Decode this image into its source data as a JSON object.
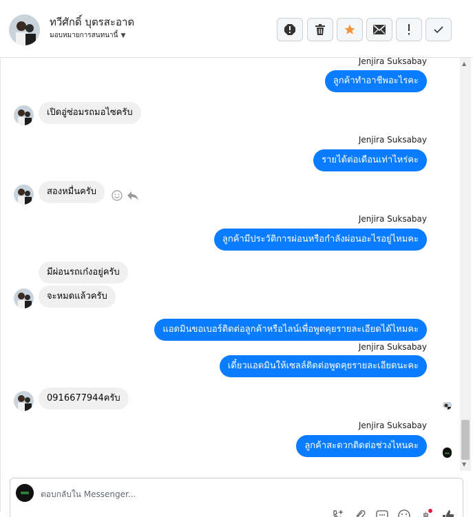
{
  "header": {
    "name": "ทวีศักดิ์ บุตรสะอาด",
    "subtitle": "มอบหมายการสนทนานี้",
    "buttons": [
      "spam-icon",
      "trash-icon",
      "star-icon",
      "mail-icon",
      "exclamation-icon",
      "check-icon"
    ],
    "star_color": "#f7923a"
  },
  "messages": {
    "m1": {
      "sender": "Jenjira Suksabay",
      "text": "ลูกค้าทำอาชีพอะไรคะ"
    },
    "m2": {
      "text": "เปิดอู่ซ่อมรถมอไซครับ"
    },
    "m3": {
      "sender": "Jenjira Suksabay",
      "text": "รายได้ต่อเดือนเท่าไหร่คะ"
    },
    "m4": {
      "text": "สองหมื่นครับ"
    },
    "m5": {
      "sender": "Jenjira Suksabay",
      "text": "ลูกค้ามีประวัติการผ่อนหรือกำลังผ่อนอะไรอยู่ไหมคะ"
    },
    "m6": {
      "text": "มีผ่อนรถเก๋งอยู่ครับ"
    },
    "m7": {
      "text": "จะหมดแล้วครับ"
    },
    "m8": {
      "text": "แอดมินขอเบอร์ติดต่อลูกค้าหรือไลน์เพื่อพูดคุยรายละเอียดได้ไหมคะ"
    },
    "m9": {
      "sender": "Jenjira Suksabay",
      "text": "เดี๋ยวแอดมินให้เซลล์ติดต่อพูดคุยรายละเอียดนะคะ"
    },
    "m10": {
      "text": "0916677944ครับ"
    },
    "m11": {
      "sender": "Jenjira Suksabay",
      "text": "ลูกค้าสะดวกติดต่อช่วงไหนคะ"
    }
  },
  "composer": {
    "placeholder": "ตอบกลับใน Messenger...",
    "tools": [
      "add-call-icon",
      "attach-icon",
      "chat-icon",
      "emoji-icon",
      "baht-icon",
      "like-icon"
    ]
  },
  "colors": {
    "outgoing_bubble": "#0a7cff",
    "incoming_bubble": "#f0f0f0"
  }
}
